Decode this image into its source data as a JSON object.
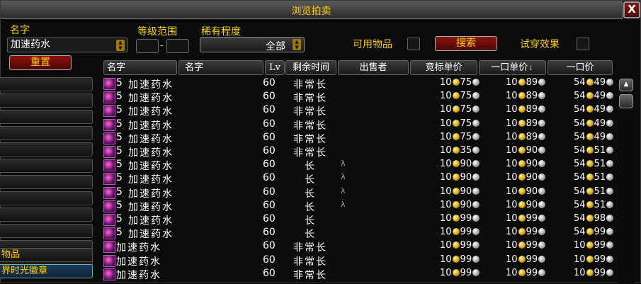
{
  "window": {
    "title": "浏览拍卖",
    "close_label": "X"
  },
  "filters": {
    "name_label": "名字",
    "name_value": "加速药水",
    "level_label": "等级范围",
    "level_separator": "-",
    "rarity_label": "稀有程度",
    "rarity_value": "全部",
    "usable_label": "可用物品",
    "search_label": "搜索",
    "preview_label": "试穿效果",
    "reset_label": "重置"
  },
  "categories": [
    {
      "label": ""
    },
    {
      "label": ""
    },
    {
      "label": ""
    },
    {
      "label": ""
    },
    {
      "label": ""
    },
    {
      "label": ""
    },
    {
      "label": ""
    },
    {
      "label": ""
    },
    {
      "label": ""
    },
    {
      "label": ""
    },
    {
      "label": ""
    },
    {
      "label": ""
    },
    {
      "label": "物品"
    },
    {
      "label": "界时光徽章"
    }
  ],
  "columns": [
    "名字",
    "名字",
    "Lv",
    "剩余时间",
    "出售者",
    "竞标单价",
    "一口单价",
    "一口价"
  ],
  "sort_indicator": "↓",
  "colors": {
    "title": "#ffd100",
    "button_red": "#8a140e",
    "gold_coin": "#d4a000",
    "silver_coin": "#a0a0a0"
  },
  "rows": [
    {
      "count": "5",
      "name": "加速药水",
      "lv": "60",
      "time": "非常长",
      "seller": "",
      "bid_g": "10",
      "bid_s": "75",
      "unit_g": "10",
      "unit_s": "89",
      "buy_g": "54",
      "buy_s": "49"
    },
    {
      "count": "5",
      "name": "加速药水",
      "lv": "60",
      "time": "非常长",
      "seller": "",
      "bid_g": "10",
      "bid_s": "75",
      "unit_g": "10",
      "unit_s": "89",
      "buy_g": "54",
      "buy_s": "49"
    },
    {
      "count": "5",
      "name": "加速药水",
      "lv": "60",
      "time": "非常长",
      "seller": "",
      "bid_g": "10",
      "bid_s": "75",
      "unit_g": "10",
      "unit_s": "89",
      "buy_g": "54",
      "buy_s": "49"
    },
    {
      "count": "5",
      "name": "加速药水",
      "lv": "60",
      "time": "非常长",
      "seller": "",
      "bid_g": "10",
      "bid_s": "75",
      "unit_g": "10",
      "unit_s": "89",
      "buy_g": "54",
      "buy_s": "49"
    },
    {
      "count": "5",
      "name": "加速药水",
      "lv": "60",
      "time": "非常长",
      "seller": "",
      "bid_g": "10",
      "bid_s": "75",
      "unit_g": "10",
      "unit_s": "89",
      "buy_g": "54",
      "buy_s": "49"
    },
    {
      "count": "5",
      "name": "加速药水",
      "lv": "60",
      "time": "非常长",
      "seller": "",
      "bid_g": "10",
      "bid_s": "35",
      "unit_g": "10",
      "unit_s": "90",
      "buy_g": "54",
      "buy_s": "51"
    },
    {
      "count": "5",
      "name": "加速药水",
      "lv": "60",
      "time": "长",
      "seller": "λ",
      "bid_g": "10",
      "bid_s": "90",
      "unit_g": "10",
      "unit_s": "90",
      "buy_g": "54",
      "buy_s": "51"
    },
    {
      "count": "5",
      "name": "加速药水",
      "lv": "60",
      "time": "长",
      "seller": "λ",
      "bid_g": "10",
      "bid_s": "90",
      "unit_g": "10",
      "unit_s": "90",
      "buy_g": "54",
      "buy_s": "51"
    },
    {
      "count": "5",
      "name": "加速药水",
      "lv": "60",
      "time": "长",
      "seller": "λ",
      "bid_g": "10",
      "bid_s": "90",
      "unit_g": "10",
      "unit_s": "90",
      "buy_g": "54",
      "buy_s": "51"
    },
    {
      "count": "5",
      "name": "加速药水",
      "lv": "60",
      "time": "长",
      "seller": "λ",
      "bid_g": "10",
      "bid_s": "90",
      "unit_g": "10",
      "unit_s": "90",
      "buy_g": "54",
      "buy_s": "51"
    },
    {
      "count": "5",
      "name": "加速药水",
      "lv": "60",
      "time": "长",
      "seller": "",
      "bid_g": "10",
      "bid_s": "99",
      "unit_g": "10",
      "unit_s": "99",
      "buy_g": "54",
      "buy_s": "98"
    },
    {
      "count": "5",
      "name": "加速药水",
      "lv": "60",
      "time": "长",
      "seller": "",
      "bid_g": "10",
      "bid_s": "99",
      "unit_g": "10",
      "unit_s": "99",
      "buy_g": "54",
      "buy_s": "99"
    },
    {
      "count": "",
      "name": "加速药水",
      "lv": "60",
      "time": "非常长",
      "seller": "",
      "bid_g": "10",
      "bid_s": "99",
      "unit_g": "10",
      "unit_s": "99",
      "buy_g": "10",
      "buy_s": "99"
    },
    {
      "count": "",
      "name": "加速药水",
      "lv": "60",
      "time": "非常长",
      "seller": "",
      "bid_g": "10",
      "bid_s": "99",
      "unit_g": "10",
      "unit_s": "99",
      "buy_g": "10",
      "buy_s": "99"
    },
    {
      "count": "",
      "name": "加速药水",
      "lv": "60",
      "time": "非常长",
      "seller": "",
      "bid_g": "10",
      "bid_s": "99",
      "unit_g": "10",
      "unit_s": "99",
      "buy_g": "10",
      "buy_s": "99"
    }
  ]
}
